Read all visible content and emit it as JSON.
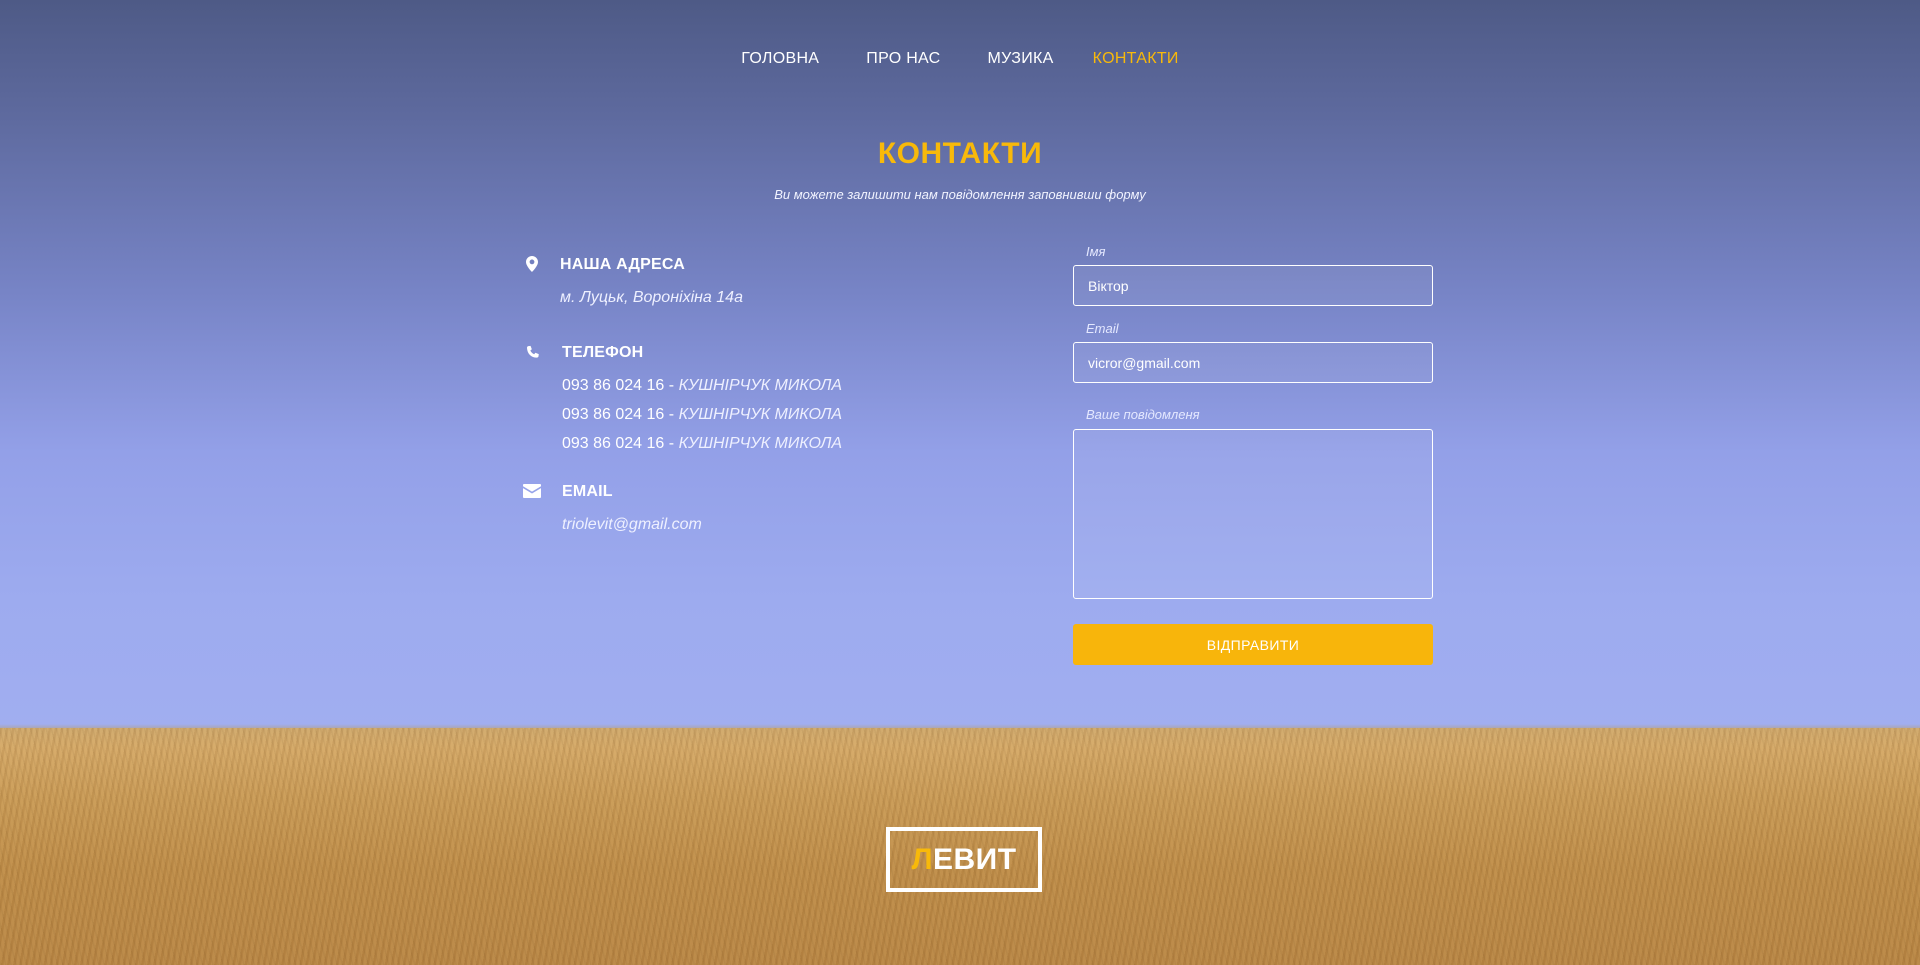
{
  "nav": {
    "items": [
      {
        "label": "ГОЛОВНА"
      },
      {
        "label": "ПРО НАС"
      },
      {
        "label": "МУЗИКА"
      },
      {
        "label": "КОНТАКТИ"
      }
    ]
  },
  "contacts": {
    "title": "КОНТАКТИ",
    "subtitle": "Ви можете залишити нам повідомлення заповнивши форму"
  },
  "info": {
    "address": {
      "icon": "map-pin-icon",
      "heading": "НАША АДРЕСА",
      "text": "м. Луцьк, Вороніхіна 14а"
    },
    "phone": {
      "icon": "phone-icon",
      "heading": "ТЕЛЕФОН",
      "separator": "-",
      "lines": [
        {
          "number": "093 86 024 16",
          "name": "КУШНІРЧУК МИКОЛА"
        },
        {
          "number": "093 86 024 16",
          "name": "КУШНІРЧУК МИКОЛА"
        },
        {
          "number": "093 86 024 16",
          "name": "КУШНІРЧУК МИКОЛА"
        }
      ]
    },
    "email": {
      "icon": "envelope-icon",
      "heading": "EMAIL",
      "text": "triolevit@gmail.com"
    }
  },
  "form": {
    "name_label": "Імя",
    "name_value": "Віктор",
    "email_label": "Email",
    "email_value": "vicror@gmail.com",
    "message_label": "Ваше повідомленя",
    "message_value": "",
    "submit_label": "ВІДПРАВИТИ"
  },
  "logo": {
    "first_letter": "Л",
    "rest": "ЕВИТ"
  },
  "colors": {
    "accent": "#f8b90a",
    "button": "#f8b50b",
    "text": "#ffffff"
  }
}
